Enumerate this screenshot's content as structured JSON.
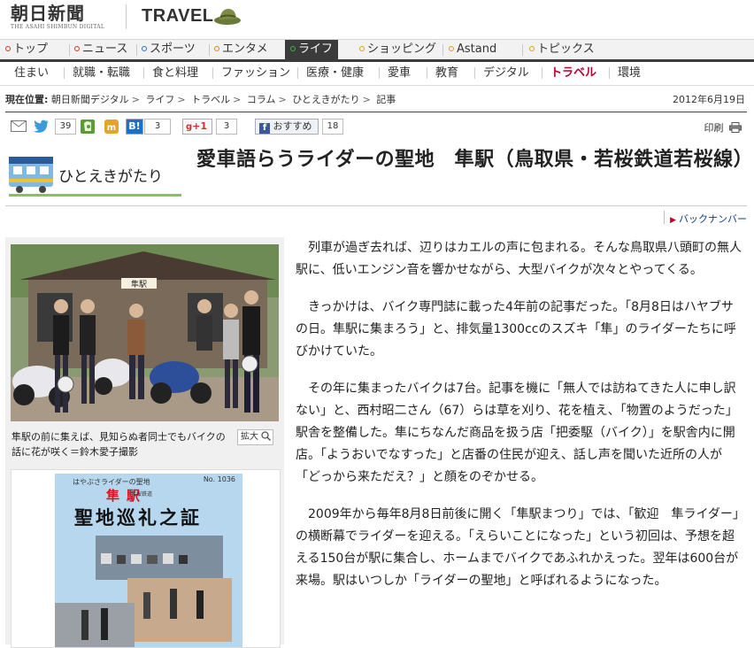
{
  "header": {
    "logo_ja": "朝日新聞",
    "logo_en": "THE ASAHI SHIMBUN DIGITAL",
    "section": "TRAVEL"
  },
  "mainnav": [
    {
      "label": "トップ",
      "dot": "#c0392b"
    },
    {
      "label": "ニュース",
      "dot": "#c0392b"
    },
    {
      "label": "スポーツ",
      "dot": "#2a6fb5"
    },
    {
      "label": "エンタメ",
      "dot": "#d68910"
    },
    {
      "label": "ライフ",
      "dot": "#2e8b57",
      "active": true
    },
    {
      "label": "ショッピング",
      "dot": "#d4a017"
    },
    {
      "label": "Astand",
      "dot": "#d4a017"
    },
    {
      "label": "トピックス",
      "dot": "#d4a017"
    }
  ],
  "subnav": [
    "住まい",
    "就職・転職",
    "食と料理",
    "ファッション",
    "医療・健康",
    "愛車",
    "教育",
    "デジタル",
    "トラベル",
    "環境"
  ],
  "breadcrumb": {
    "label": "現在位置:",
    "items": [
      "朝日新聞デジタル",
      "ライフ",
      "トラベル",
      "コラム",
      "ひとえきがたり",
      "記事"
    ]
  },
  "date": "2012年6月19日",
  "share": {
    "twitter_count": "39",
    "hatena_label": "B!",
    "hatena_count": "3",
    "gplus_label": "+1",
    "gplus_count": "3",
    "fb_label": "おすすめ",
    "fb_count": "18"
  },
  "print_label": "印刷",
  "column_logo_text": "ひとえきがたり",
  "article": {
    "title": "愛車語らうライダーの聖地　隼駅（鳥取県・若桜鉄道若桜線）",
    "back_number": "バックナンバー",
    "photo_caption": "隼駅の前に集えば、見知らぬ者同士でもバイクの話に花が咲く＝鈴木愛子撮影",
    "zoom_label": "拡大",
    "paragraphs": [
      "列車が過ぎ去れば、辺りはカエルの声に包まれる。そんな鳥取県八頭町の無人駅に、低いエンジン音を響かせながら、大型バイクが次々とやってくる。",
      "きっかけは、バイク専門誌に載った4年前の記事だった。「8月8日はハヤブサの日。隼駅に集まろう」と、排気量1300ccのスズキ「隼」のライダーたちに呼びかけていた。",
      "その年に集まったバイクは7台。記事を機に「無人では訪ねてきた人に申し訳ない」と、西村昭二さん（67）らは草を刈り、花を植え、「物置のようだった」駅舎を整備した。隼にちなんだ商品を扱う店「把委駆（バイク）」を駅舎内に開店。「ようおいでなすった」と店番の住民が迎え、話し声を聞いた近所の人が「どっから来ただえ？」と顔をのぞかせる。",
      "2009年から毎年8月8日前後に開く「隼駅まつり」では、「歓迎　隼ライダー」の横断幕でライダーを迎える。「えらいことになった」という初回は、予想を超える150台が駅に集合し、ホームまでバイクであふれかえった。翌年は600台が来場。駅はいつしか「ライダーの聖地」と呼ばれるようになった。"
    ]
  },
  "station_sign": "隼駅",
  "certificate": {
    "subtitle": "はやぶさライダーの聖地",
    "no": "No. 1036",
    "railway": "若桜鉄道",
    "name": "隼駅",
    "title": "聖地巡礼之証"
  }
}
